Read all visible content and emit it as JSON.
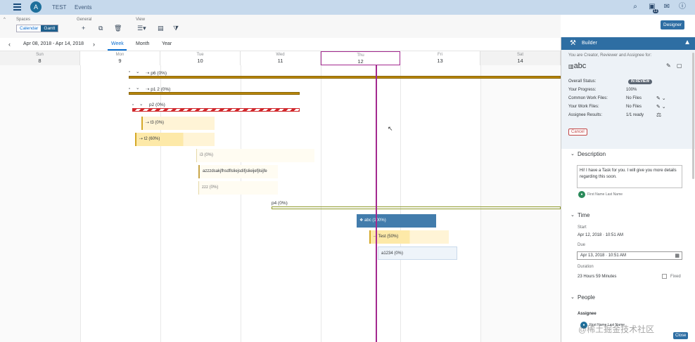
{
  "shell": {
    "title": "TEST",
    "subtitle": "Events",
    "notif_count": "11",
    "avatar_initial": "A"
  },
  "toolbar": {
    "spaces_label": "Spaces",
    "general_label": "General",
    "view_label": "View",
    "calendar_label": "Calendar",
    "gantt_label": "Gantt",
    "designer_label": "Designer"
  },
  "nav": {
    "date_range": "Apr 08, 2018 - Apr 14, 2018",
    "tabs": [
      "Week",
      "Month",
      "Year"
    ]
  },
  "days": [
    {
      "name": "Sun",
      "date": "8"
    },
    {
      "name": "Mon",
      "date": "9"
    },
    {
      "name": "Tue",
      "date": "10"
    },
    {
      "name": "Wed",
      "date": "11"
    },
    {
      "name": "Thu",
      "date": "12"
    },
    {
      "name": "Fri",
      "date": "13"
    },
    {
      "name": "Sat",
      "date": "14"
    }
  ],
  "rows": {
    "p6": "p6 (0%)",
    "p1_2": "p1 2 (0%)",
    "p2": "p2 (0%)",
    "t3": "t3 (0%)",
    "t2": "t2 (60%)",
    "i3": "i3 (0%)",
    "azz": "azzzdsakjfhsdflsliejsdifjslieijefjlsijfe",
    "zzz": "zzz (0%)",
    "p4": "p4 (0%)",
    "abc": "abc (100%)",
    "test": "Test (50%)",
    "a1234": "a1234 (0%)"
  },
  "panel": {
    "title": "Builder",
    "role_text": "You are Creator, Reviewer and Assignee for:",
    "task_name": "abc",
    "overall_status_label": "Overall Status:",
    "overall_status_value": "IN REVIEW",
    "progress_label": "Your Progress:",
    "progress_value": "100%",
    "common_files_label": "Common Work Files:",
    "common_files_value": "No Files",
    "your_files_label": "Your Work Files:",
    "your_files_value": "No Files",
    "assignee_results_label": "Assignee Results:",
    "assignee_results_value": "1/1 ready",
    "cancel_label": "Cancel",
    "description_title": "Description",
    "description_text": "Hi! I have a Task for you. I will give you more details regarding this soon.",
    "desc_author": "First Name Last Name",
    "time_title": "Time",
    "start_label": "Start",
    "start_value": "Apr 12, 2018 · 10:51 AM",
    "due_label": "Due",
    "due_value": "Apr 13, 2018 · 10:51 AM",
    "duration_label": "Duration",
    "duration_value": "23 Hours 59 Minutes",
    "fixed_label": "Fixed",
    "people_title": "People",
    "assignee_label": "Assignee",
    "assignee_name": "First Name Last Name",
    "close_label": "Close"
  },
  "watermark": "@稀土掘金技术社区",
  "colors": {
    "shell_bg": "#c6d9ec",
    "brand_blue": "#2e6ea3",
    "today_line": "#a3288f",
    "gold_bar": "#b8860b",
    "stripe_red": "#d0262a"
  }
}
